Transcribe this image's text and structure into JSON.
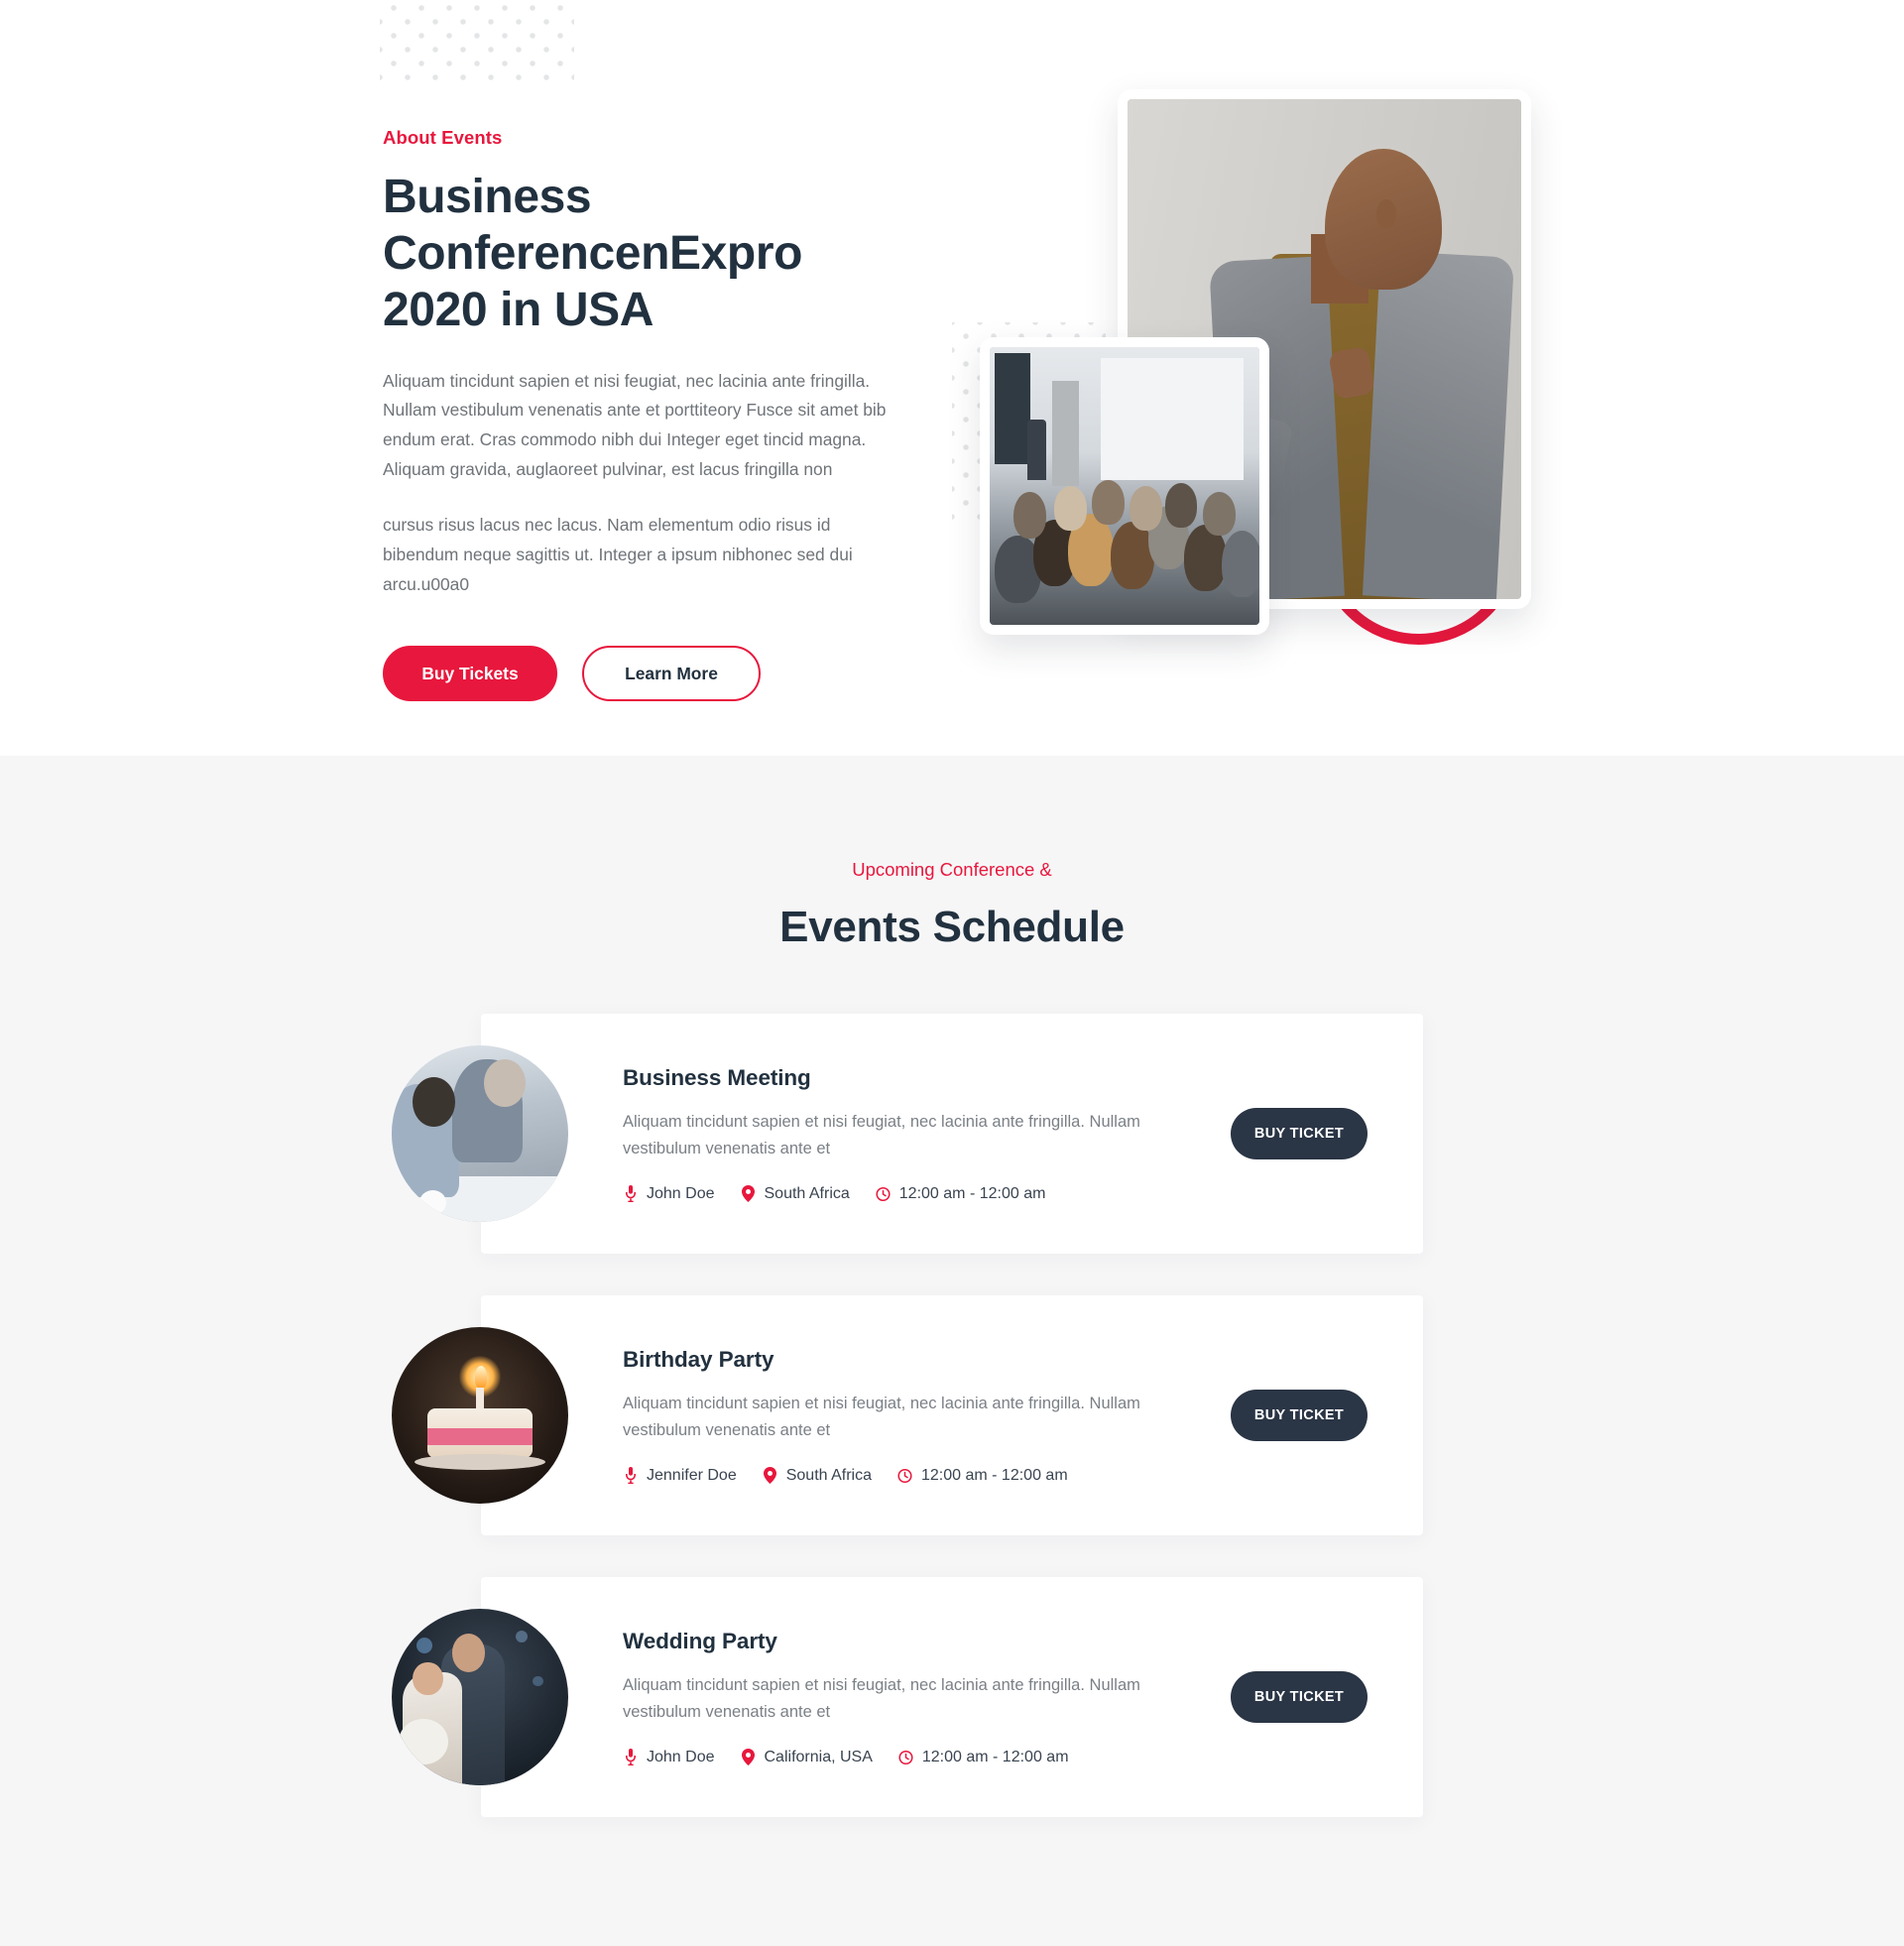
{
  "about": {
    "eyebrow": "About Events",
    "title": "Business ConferencenExpro 2020 in USA",
    "paragraph1": "Aliquam tincidunt sapien et nisi feugiat, nec lacinia ante fringilla. Nullam vestibulum venenatis ante et porttiteory Fusce sit amet bib endum erat. Cras commodo nibh dui Integer eget tincid magna. Aliquam gravida, auglaoreet pulvinar, est lacus fringilla non",
    "paragraph2": "cursus risus lacus nec lacus. Nam elementum odio risus id bibendum neque sagittis ut. Integer a ipsum nibhonec sed dui arcu.u00a0",
    "primary_button": "Buy Tickets",
    "secondary_button": "Learn More",
    "accent_color": "#e8173d",
    "heading_color": "#22313f",
    "media": {
      "large_photo_alt": "smiling speaker in grey blazer",
      "small_photo_alt": "conference audience seated in rows",
      "decor_ring_color": "#e8173d",
      "dot_pattern_color": "#e4e5e7"
    }
  },
  "schedule": {
    "eyebrow": "Upcoming Conference &",
    "title": "Events Schedule",
    "background_color": "#f6f6f7",
    "ticket_button_color": "#2a3545",
    "events": [
      {
        "title": "Business Meeting",
        "description": "Aliquam tincidunt sapien et nisi feugiat, nec lacinia ante fringilla. Nullam vestibulum venenatis ante et",
        "speaker": "John Doe",
        "location": "South Africa",
        "time": "12:00 am - 12:00 am",
        "button": "BUY TICKET",
        "thumb_alt": "two businessmen talking at a table"
      },
      {
        "title": "Birthday Party",
        "description": "Aliquam tincidunt sapien et nisi feugiat, nec lacinia ante fringilla. Nullam vestibulum venenatis ante et",
        "speaker": "Jennifer Doe",
        "location": "South Africa",
        "time": "12:00 am - 12:00 am",
        "button": "BUY TICKET",
        "thumb_alt": "lit candle on a happy birthday cake"
      },
      {
        "title": "Wedding Party",
        "description": "Aliquam tincidunt sapien et nisi feugiat, nec lacinia ante fringilla. Nullam vestibulum venenatis ante et",
        "speaker": "John Doe",
        "location": "California, USA",
        "time": "12:00 am - 12:00 am",
        "button": "BUY TICKET",
        "thumb_alt": "bride and groom at a wedding"
      }
    ],
    "icons": {
      "speaker": "microphone-icon",
      "location": "map-pin-icon",
      "time": "clock-icon"
    }
  }
}
